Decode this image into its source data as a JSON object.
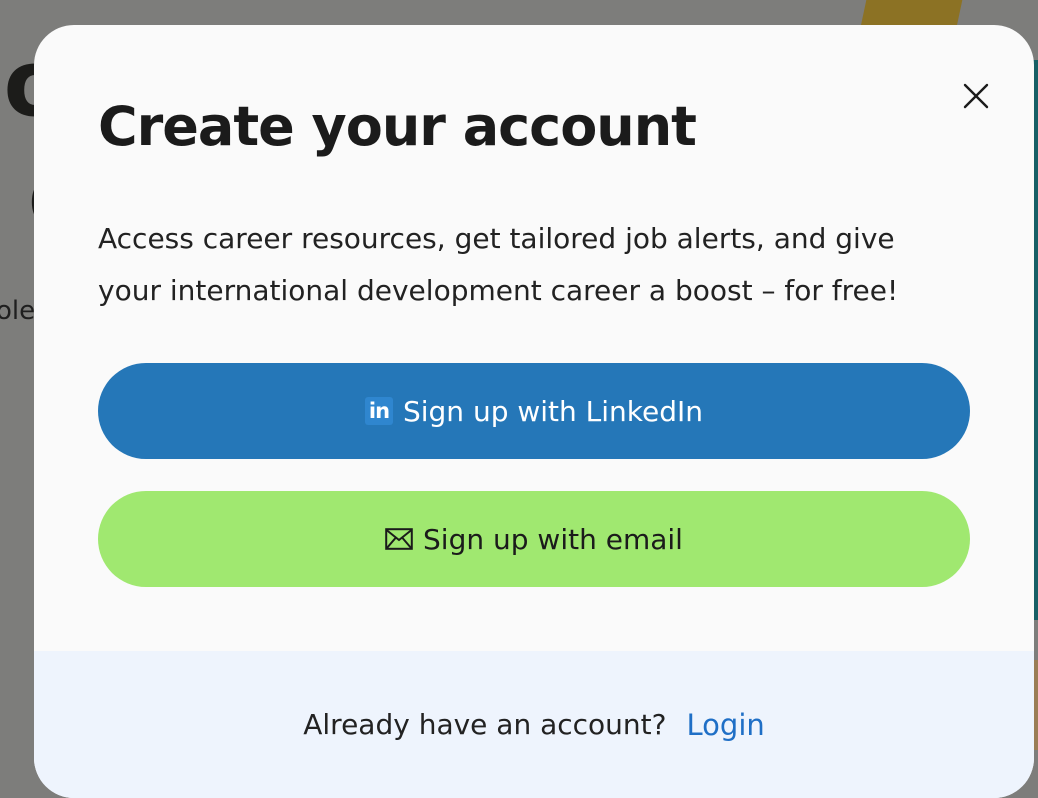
{
  "background": {
    "heading_fragment_line1": "jo",
    "heading_fragment_line2": "l c",
    "text_fragment": "ole"
  },
  "modal": {
    "title": "Create your account",
    "description": "Access career resources, get tailored job alerts, and give your international development career a boost – for free!",
    "close_icon": "close-icon",
    "buttons": {
      "linkedin": {
        "icon": "linkedin-icon",
        "icon_text": "in",
        "label": "Sign up with LinkedIn"
      },
      "email": {
        "icon": "envelope-icon",
        "label": "Sign up with email"
      }
    },
    "footer": {
      "prompt": "Already have an account?",
      "login_label": "Login"
    }
  },
  "colors": {
    "linkedin_button": "#2577b8",
    "email_button": "#a0e870",
    "login_link": "#1f6fc6",
    "footer_background": "#eef4fd",
    "modal_background": "#fafafa",
    "overlay": "#7d7d7b"
  }
}
